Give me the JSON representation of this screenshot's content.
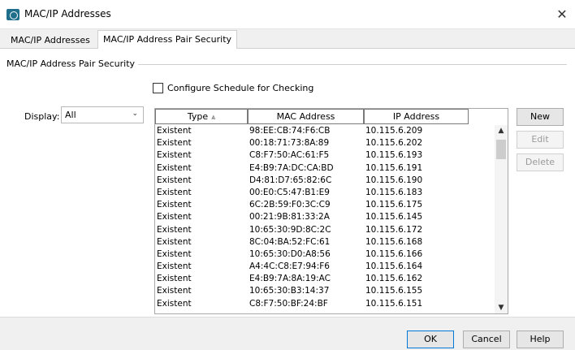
{
  "window": {
    "title": "MAC/IP Addresses",
    "close_glyph": "✕"
  },
  "tabs": [
    {
      "label": "MAC/IP Addresses"
    },
    {
      "label": "MAC/IP Address Pair Security"
    }
  ],
  "group": {
    "title": "MAC/IP Address Pair Security"
  },
  "schedule_checkbox": {
    "label": "Configure Schedule for Checking",
    "checked": false
  },
  "display": {
    "label": "Display:",
    "value": "All"
  },
  "table": {
    "headers": [
      "Type",
      "MAC Address",
      "IP Address"
    ],
    "sort_indicator": "⩓",
    "rows": [
      [
        "Existent",
        "98:EE:CB:74:F6:CB",
        "10.115.6.209"
      ],
      [
        "Existent",
        "00:18:71:73:8A:89",
        "10.115.6.202"
      ],
      [
        "Existent",
        "C8:F7:50:AC:61:F5",
        "10.115.6.193"
      ],
      [
        "Existent",
        "E4:B9:7A:DC:CA:BD",
        "10.115.6.191"
      ],
      [
        "Existent",
        "D4:81:D7:65:82:6C",
        "10.115.6.190"
      ],
      [
        "Existent",
        "00:E0:C5:47:B1:E9",
        "10.115.6.183"
      ],
      [
        "Existent",
        "6C:2B:59:F0:3C:C9",
        "10.115.6.175"
      ],
      [
        "Existent",
        "00:21:9B:81:33:2A",
        "10.115.6.145"
      ],
      [
        "Existent",
        "10:65:30:9D:8C:2C",
        "10.115.6.172"
      ],
      [
        "Existent",
        "8C:04:BA:52:FC:61",
        "10.115.6.168"
      ],
      [
        "Existent",
        "10:65:30:D0:A8:56",
        "10.115.6.166"
      ],
      [
        "Existent",
        "A4:4C:C8:E7:94:F6",
        "10.115.6.164"
      ],
      [
        "Existent",
        "E4:B9:7A:8A:19:AC",
        "10.115.6.162"
      ],
      [
        "Existent",
        "10:65:30:B3:14:37",
        "10.115.6.155"
      ],
      [
        "Existent",
        "C8:F7:50:BF:24:BF",
        "10.115.6.151"
      ]
    ]
  },
  "side_buttons": {
    "new": "New",
    "edit": "Edit",
    "delete": "Delete"
  },
  "footer": {
    "ok": "OK",
    "cancel": "Cancel",
    "help": "Help"
  },
  "icons": {
    "app": "network-icon",
    "close": "close-icon",
    "chevron": "chevron-down-icon",
    "sort": "sort-ascending-icon"
  },
  "colors": {
    "accent": "#0078d7",
    "disabled_text": "#9a9a9a"
  }
}
